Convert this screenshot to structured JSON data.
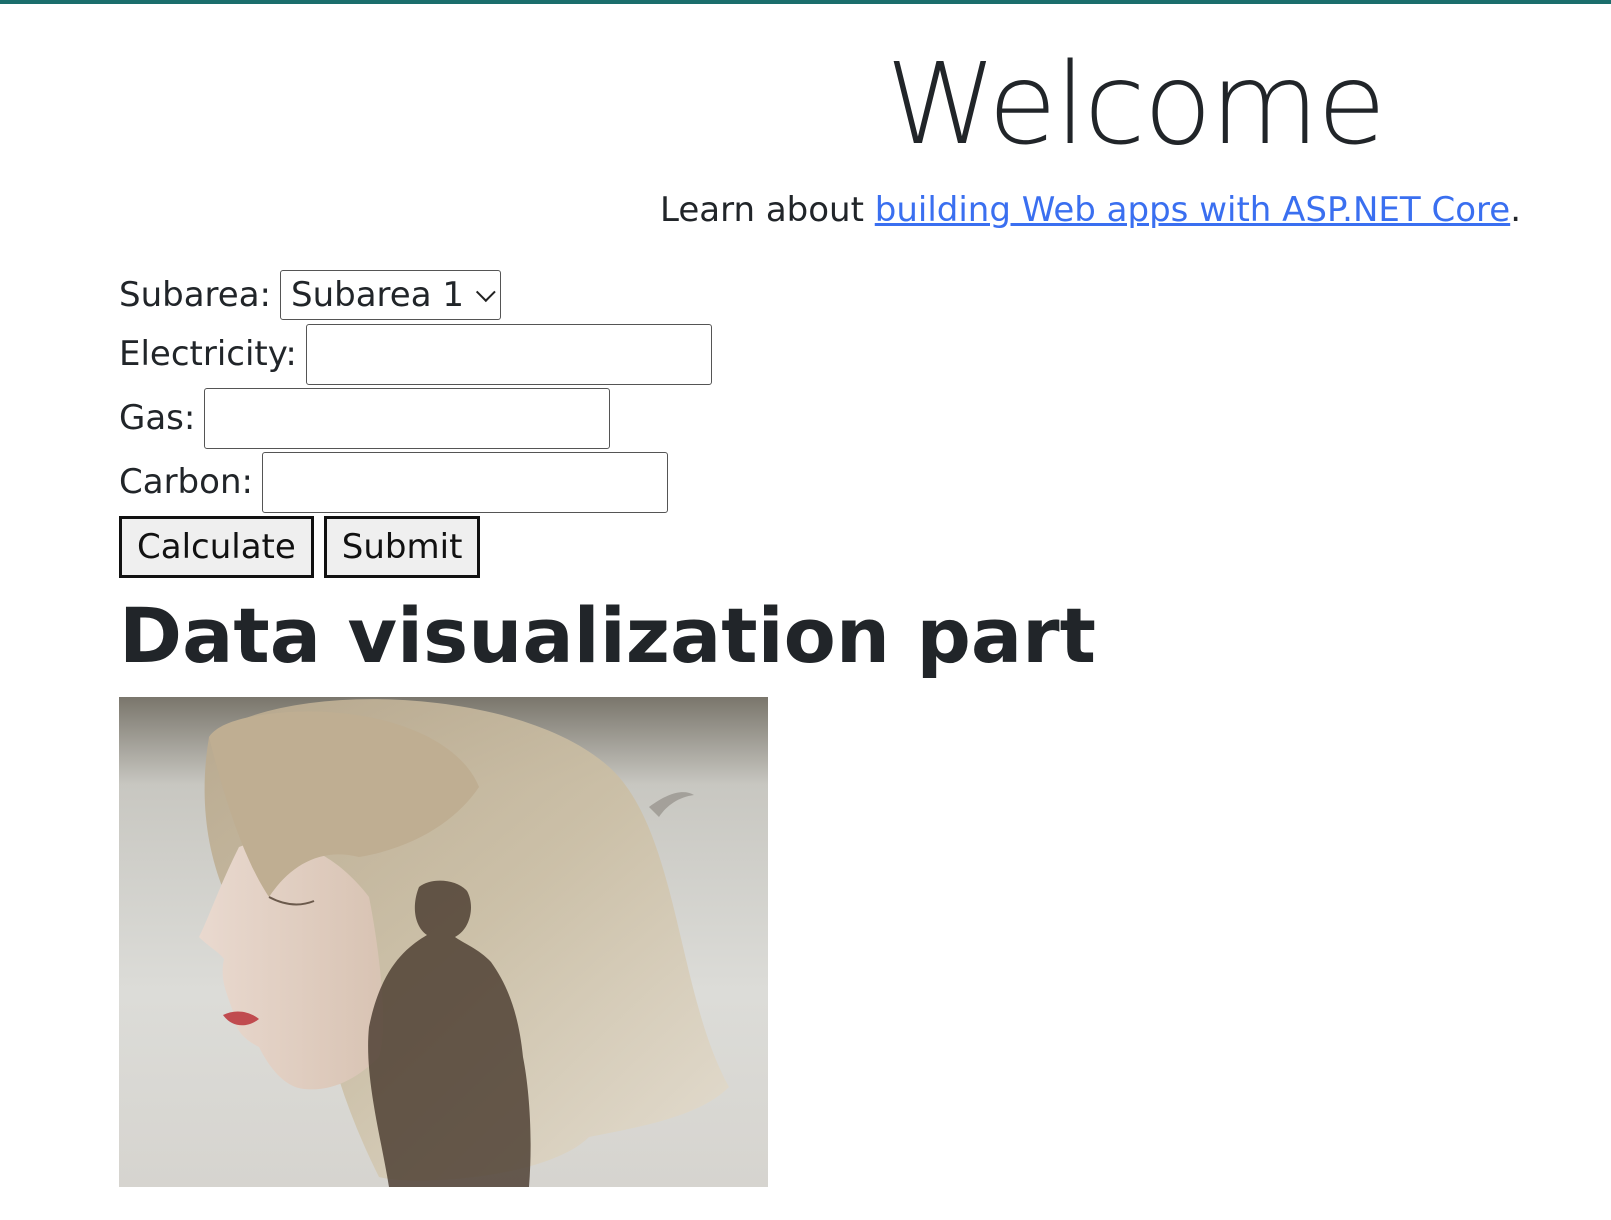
{
  "header": {
    "title": "Welcome",
    "learn_prefix": "Learn about ",
    "learn_link": "building Web apps with ASP.NET Core",
    "learn_suffix": "."
  },
  "form": {
    "subarea_label": "Subarea:",
    "subarea_value": "Subarea 1",
    "electricity_label": "Electricity:",
    "electricity_value": "",
    "gas_label": "Gas:",
    "gas_value": "",
    "carbon_label": "Carbon:",
    "carbon_value": "",
    "calculate_label": "Calculate",
    "submit_label": "Submit"
  },
  "visualization": {
    "title": "Data visualization part"
  },
  "colors": {
    "top_bar": "#1b6e6c",
    "link": "#3a6ff0"
  }
}
